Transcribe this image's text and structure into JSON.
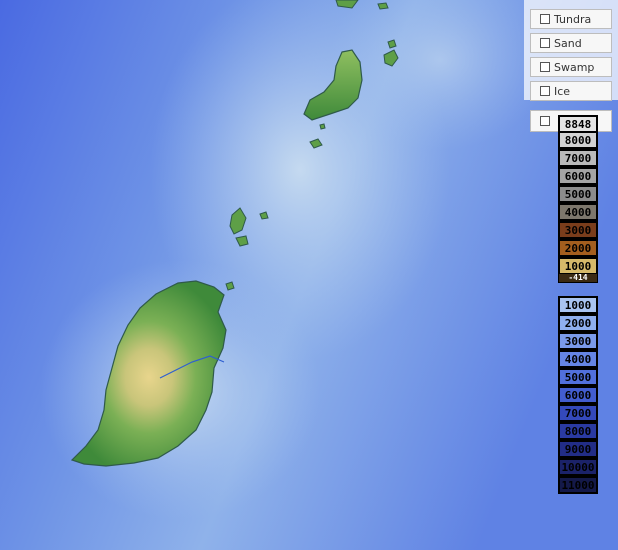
{
  "layer_options": [
    {
      "label": "Tundra",
      "checked": false
    },
    {
      "label": "Sand",
      "checked": false
    },
    {
      "label": "Swamp",
      "checked": false
    },
    {
      "label": "Ice",
      "checked": false
    }
  ],
  "elevation_toggle": {
    "checked": false
  },
  "elevation_legend": [
    {
      "label": "8848",
      "color": "#e4e4e4",
      "text": "#000"
    },
    {
      "label": "8000",
      "color": "#d2d2d2",
      "text": "#000"
    },
    {
      "label": "7000",
      "color": "#bababa",
      "text": "#000"
    },
    {
      "label": "6000",
      "color": "#a4a4a4",
      "text": "#000"
    },
    {
      "label": "5000",
      "color": "#8c8c8c",
      "text": "#000"
    },
    {
      "label": "4000",
      "color": "#7d776c",
      "text": "#000"
    },
    {
      "label": "3000",
      "color": "#7a3d1b",
      "text": "#000"
    },
    {
      "label": "2000",
      "color": "#a35e1e",
      "text": "#000"
    },
    {
      "label": "1000",
      "color": "#d6b96a",
      "text": "#000"
    },
    {
      "label": "-414",
      "color": "#3b2a14",
      "text": "#fff"
    }
  ],
  "depth_legend": [
    {
      "label": "1000",
      "color": "#a9c4f1",
      "text": "#000"
    },
    {
      "label": "2000",
      "color": "#8fafee",
      "text": "#000"
    },
    {
      "label": "3000",
      "color": "#7a9aea",
      "text": "#000"
    },
    {
      "label": "4000",
      "color": "#6585e4",
      "text": "#000"
    },
    {
      "label": "5000",
      "color": "#5170dc",
      "text": "#000"
    },
    {
      "label": "6000",
      "color": "#425dcf",
      "text": "#000"
    },
    {
      "label": "7000",
      "color": "#3449bb",
      "text": "#000"
    },
    {
      "label": "8000",
      "color": "#2a3aa2",
      "text": "#000"
    },
    {
      "label": "9000",
      "color": "#222d86",
      "text": "#000"
    },
    {
      "label": "10000",
      "color": "#1b2269",
      "text": "#000"
    },
    {
      "label": "11000",
      "color": "#141949",
      "text": "#000"
    }
  ]
}
